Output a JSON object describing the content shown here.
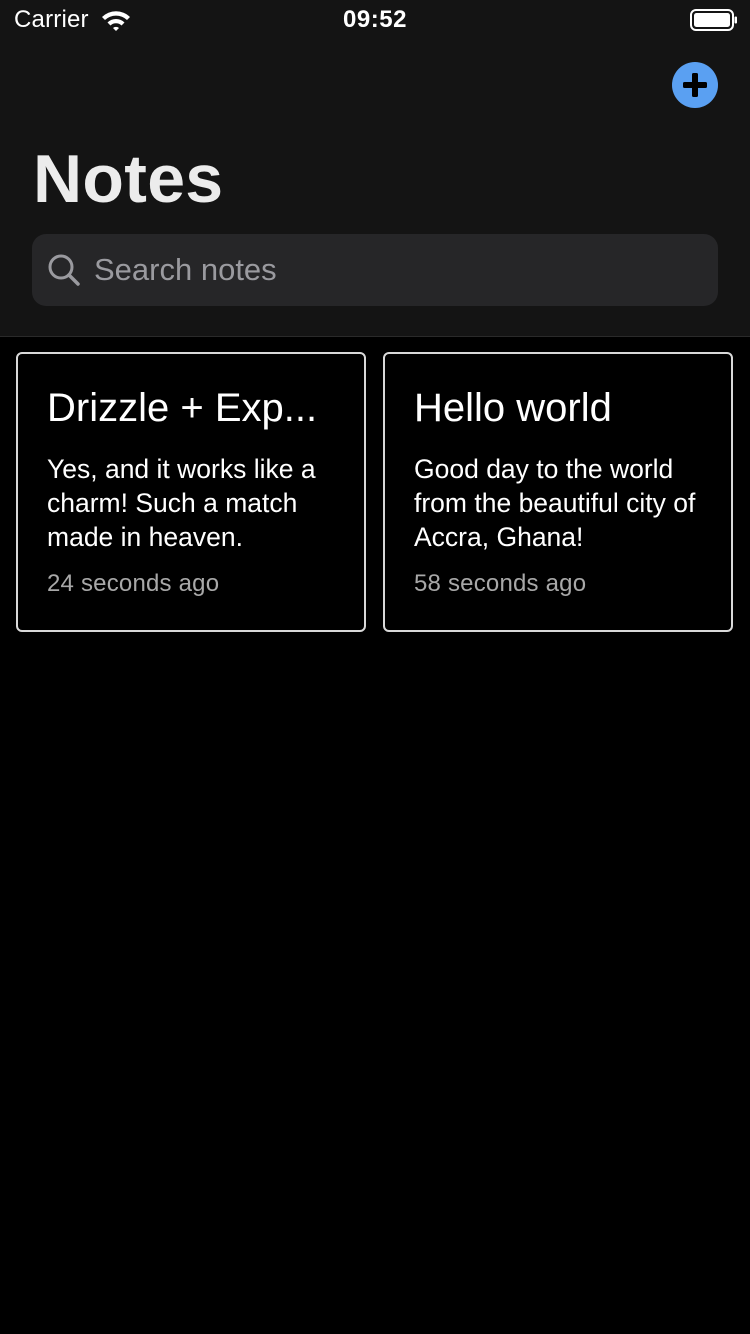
{
  "status_bar": {
    "carrier": "Carrier",
    "time": "09:52"
  },
  "header": {
    "title": "Notes",
    "add_icon": "plus-circle-icon",
    "accent_color": "#5aa0f2"
  },
  "search": {
    "placeholder": "Search notes",
    "value": ""
  },
  "notes": [
    {
      "title": "Drizzle + Exp...",
      "body": "Yes, and it works like a charm! Such a match made in heaven.",
      "time": "24 seconds ago"
    },
    {
      "title": "Hello world",
      "body": "Good day to the world from the beautiful city of Accra, Ghana!",
      "time": "58 seconds ago"
    }
  ]
}
